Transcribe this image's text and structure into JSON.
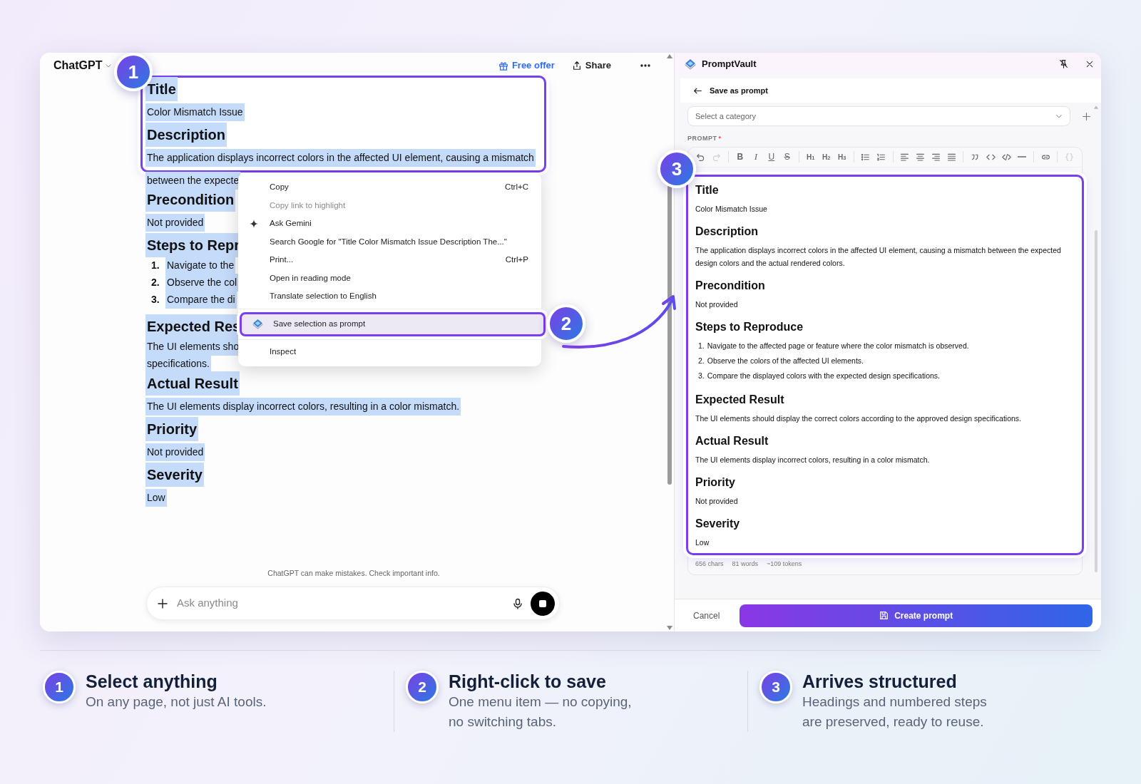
{
  "chat": {
    "title": "ChatGPT",
    "header_actions": [
      {
        "kind": "offer",
        "label": "Free offer"
      },
      {
        "kind": "share",
        "label": "Share"
      },
      {
        "kind": "more"
      }
    ],
    "framed_blocks": [
      {
        "kind": "heading",
        "lines": [
          "Title"
        ],
        "selected": true
      },
      {
        "kind": "para",
        "lines": [
          "Color Mismatch Issue"
        ],
        "selected": true
      },
      {
        "kind": "heading",
        "lines": [
          "Description"
        ],
        "selected": true
      },
      {
        "kind": "para",
        "lines": [
          "The application displays incorrect colors in the affected UI element, causing a mismatch"
        ],
        "selected": true
      }
    ],
    "blocks": [
      {
        "kind": "tail",
        "lines": [
          "between the expecte"
        ],
        "selected": true
      },
      {
        "kind": "heading",
        "lines": [
          "Precondition"
        ],
        "selected": true
      },
      {
        "kind": "para",
        "lines": [
          "Not provided"
        ],
        "selected": true
      },
      {
        "kind": "heading",
        "lines": [
          "Steps to Repr"
        ],
        "selected": true
      },
      {
        "kind": "step",
        "number": "1.",
        "lines": [
          "Navigate to the"
        ],
        "selected": true
      },
      {
        "kind": "step",
        "number": "2.",
        "lines": [
          "Observe the col"
        ],
        "selected": true
      },
      {
        "kind": "step",
        "number": "3.",
        "lines": [
          "Compare the di"
        ],
        "selected": true
      },
      {
        "kind": "heading",
        "lines": [
          "Expected Res"
        ],
        "selected": true
      },
      {
        "kind": "para",
        "lines": [
          "The UI elements sho",
          "specifications."
        ],
        "selected": true
      },
      {
        "kind": "heading",
        "lines": [
          "Actual Result"
        ],
        "selected": true
      },
      {
        "kind": "para",
        "lines": [
          "The UI elements display incorrect colors, resulting in a color mismatch."
        ],
        "selected": true
      },
      {
        "kind": "heading",
        "lines": [
          "Priority"
        ],
        "selected": true
      },
      {
        "kind": "para",
        "lines": [
          "Not provided"
        ],
        "selected": true
      },
      {
        "kind": "heading",
        "lines": [
          "Severity"
        ],
        "selected": true
      },
      {
        "kind": "para",
        "lines": [
          "Low"
        ],
        "selected": true
      }
    ],
    "disclaimer": "ChatGPT can make mistakes. Check important info.",
    "composer": {
      "placeholder": "Ask anything"
    }
  },
  "context_menu": {
    "groups": [
      [
        {
          "kind": "plain",
          "label": "Copy",
          "shortcut": "Ctrl+C",
          "disabled": false,
          "selected": false
        },
        {
          "kind": "plain",
          "label": "Copy link to highlight",
          "disabled": true,
          "selected": false
        },
        {
          "kind": "assistant",
          "label": "Ask Gemini",
          "disabled": false,
          "selected": false
        },
        {
          "kind": "plain",
          "label": "Search Google for \"Title Color Mismatch Issue  Description The...\"",
          "disabled": false,
          "selected": false
        },
        {
          "kind": "plain",
          "label": "Print...",
          "shortcut": "Ctrl+P",
          "disabled": false,
          "selected": false
        },
        {
          "kind": "plain",
          "label": "Open in reading mode",
          "disabled": false,
          "selected": false
        },
        {
          "kind": "plain",
          "label": "Translate selection to English",
          "disabled": false,
          "selected": false
        }
      ],
      [
        {
          "kind": "extension",
          "label": "Save selection as prompt",
          "disabled": false,
          "selected": true
        }
      ],
      [
        {
          "kind": "plain",
          "label": "Inspect",
          "disabled": false,
          "selected": false
        }
      ]
    ]
  },
  "panel": {
    "title": "PromptVault",
    "view_title": "Save as prompt",
    "category": {
      "placeholder": "Select a category"
    },
    "prompt_label": "PROMPT",
    "required_mark": "*",
    "toolbar": [
      [
        {
          "kind": "undo",
          "disabled": false
        },
        {
          "kind": "redo",
          "disabled": true
        }
      ],
      [
        {
          "kind": "bold",
          "label": "B",
          "disabled": false
        },
        {
          "kind": "italic",
          "label": "I",
          "disabled": false
        },
        {
          "kind": "underline",
          "label": "U",
          "disabled": false
        },
        {
          "kind": "strike",
          "label": "S",
          "disabled": false
        }
      ],
      [
        {
          "kind": "heading",
          "label": "H$_{1}$",
          "disabled": false
        },
        {
          "kind": "heading",
          "label": "H$_{2}$",
          "disabled": false
        },
        {
          "kind": "heading",
          "label": "H$_{3}$",
          "disabled": false
        }
      ],
      [
        {
          "kind": "bullets",
          "disabled": false
        },
        {
          "kind": "numbers",
          "disabled": false
        }
      ],
      [
        {
          "kind": "align-left",
          "disabled": false
        },
        {
          "kind": "align-center",
          "disabled": false
        },
        {
          "kind": "align-right",
          "disabled": false
        },
        {
          "kind": "justify",
          "disabled": false
        }
      ],
      [
        {
          "kind": "quote",
          "disabled": false
        },
        {
          "kind": "code",
          "disabled": false
        },
        {
          "kind": "code-block",
          "disabled": false
        },
        {
          "kind": "rule",
          "disabled": false
        }
      ],
      [
        {
          "kind": "link",
          "disabled": false
        }
      ],
      [
        {
          "kind": "braces",
          "disabled": true
        }
      ]
    ],
    "content": [
      {
        "kind": "heading",
        "text": "Title"
      },
      {
        "kind": "para",
        "text": "Color Mismatch Issue"
      },
      {
        "kind": "heading",
        "text": "Description"
      },
      {
        "kind": "para",
        "text": "The application displays incorrect colors in the affected UI element, causing a mismatch between the expected design colors and the actual rendered colors."
      },
      {
        "kind": "heading",
        "text": "Precondition"
      },
      {
        "kind": "para",
        "text": "Not provided"
      },
      {
        "kind": "heading",
        "text": "Steps to Reproduce"
      },
      {
        "kind": "step",
        "number": "1.",
        "text": "Navigate to the affected page or feature where the color mismatch is observed."
      },
      {
        "kind": "step",
        "number": "2.",
        "text": "Observe the colors of the affected UI elements."
      },
      {
        "kind": "step",
        "number": "3.",
        "text": "Compare the displayed colors with the expected design specifications."
      },
      {
        "kind": "heading",
        "text": "Expected Result"
      },
      {
        "kind": "para",
        "text": "The UI elements should display the correct colors according to the approved design specifications."
      },
      {
        "kind": "heading",
        "text": "Actual Result"
      },
      {
        "kind": "para",
        "text": "The UI elements display incorrect colors, resulting in a color mismatch."
      },
      {
        "kind": "heading",
        "text": "Priority"
      },
      {
        "kind": "para",
        "text": "Not provided"
      },
      {
        "kind": "heading",
        "text": "Severity"
      },
      {
        "kind": "para",
        "text": "Low"
      }
    ],
    "stats": [
      "656 chars",
      "81 words",
      "~109 tokens"
    ],
    "cancel": "Cancel",
    "submit": "Create prompt"
  },
  "callouts": [
    {
      "number": "1"
    },
    {
      "number": "2"
    },
    {
      "number": "3"
    }
  ],
  "steps": [
    {
      "number": "1",
      "title": "Select anything",
      "text": "On any page, not just AI tools."
    },
    {
      "number": "2",
      "title": "Right-click to save",
      "text": "One menu item — no copying, no switching tabs."
    },
    {
      "number": "3",
      "title": "Arrives structured",
      "text": "Headings and numbered steps are preserved, ready to reuse."
    }
  ]
}
